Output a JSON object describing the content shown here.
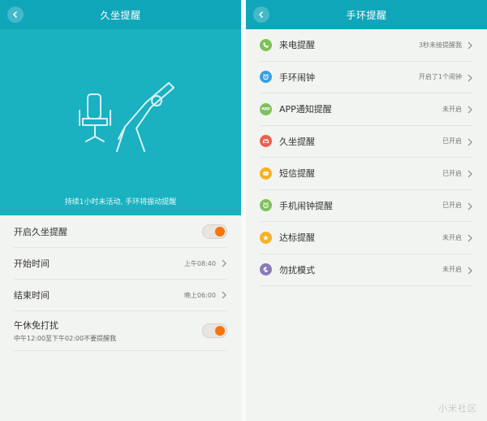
{
  "left": {
    "title": "久坐提醒",
    "hero_caption": "持续1小时未活动, 手环将振动提醒",
    "rows": [
      {
        "label": "开启久坐提醒"
      },
      {
        "label": "开始时间",
        "value": "上午08:40"
      },
      {
        "label": "结束时间",
        "value": "晚上06:00"
      },
      {
        "label": "午休免打扰",
        "sub": "中午12:00至下午02:00不要提醒我"
      }
    ]
  },
  "right": {
    "title": "手环提醒",
    "items": [
      {
        "label": "来电提醒",
        "value": "3秒未接提醒我",
        "icon": "phone-icon",
        "color": "#7ec15a"
      },
      {
        "label": "手环闹钟",
        "value": "开启了1个闹钟",
        "icon": "alarm-clock-icon",
        "color": "#3a9ee4"
      },
      {
        "label": "APP通知提醒",
        "value": "未开启",
        "icon": "app-icon",
        "icon_text": "app",
        "color": "#7ec15a"
      },
      {
        "label": "久坐提醒",
        "value": "已开启",
        "icon": "sofa-icon",
        "color": "#ee5f4e"
      },
      {
        "label": "短信提醒",
        "value": "已开启",
        "icon": "message-icon",
        "color": "#f5b225"
      },
      {
        "label": "手机闹钟提醒",
        "value": "已开启",
        "icon": "phone-alarm-icon",
        "color": "#7ec15a"
      },
      {
        "label": "达标提醒",
        "value": "未开启",
        "icon": "star-icon",
        "color": "#f5b225"
      },
      {
        "label": "勿扰模式",
        "value": "未开启",
        "icon": "moon-icon",
        "color": "#8a7ab5"
      }
    ]
  },
  "watermark": "小米社区"
}
